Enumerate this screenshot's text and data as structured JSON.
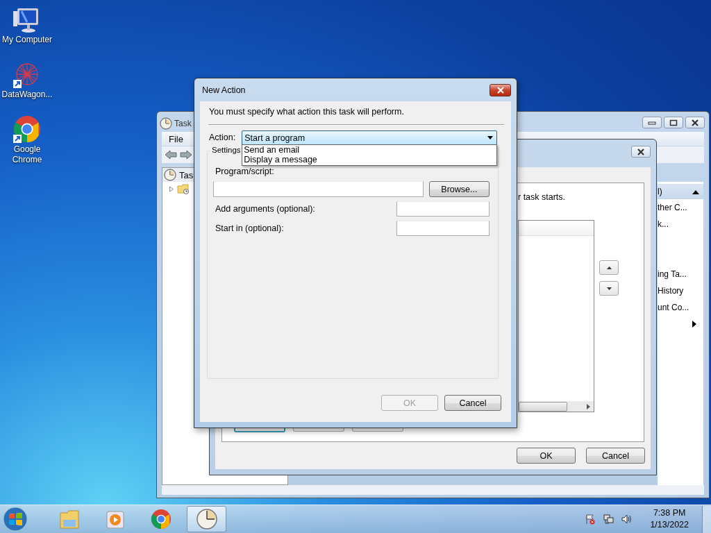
{
  "desktop": {
    "icons": [
      {
        "label": "My Computer",
        "kind": "computer",
        "shortcut": false
      },
      {
        "label": "DataWagon...",
        "kind": "network",
        "shortcut": true
      },
      {
        "label": "Google Chrome",
        "kind": "chrome",
        "shortcut": true
      }
    ]
  },
  "task_scheduler": {
    "title": "Task",
    "menu": [
      "File"
    ],
    "tree": [
      {
        "label": "Tas",
        "children": [
          {
            "expanded": false
          }
        ]
      }
    ],
    "actions": {
      "header": "l)",
      "expanded": true,
      "items": [
        {
          "kind": "text",
          "label": "ther C..."
        },
        {
          "kind": "text",
          "label": "k..."
        },
        {
          "kind": "text",
          "label": "ing Ta..."
        },
        {
          "kind": "text",
          "label": "History"
        },
        {
          "kind": "text",
          "label": "unt Co..."
        },
        {
          "kind": "submenu"
        }
      ]
    }
  },
  "create_task": {
    "text": "r task starts.",
    "buttons": [
      {
        "label": "OK"
      },
      {
        "label": "Cancel"
      }
    ]
  },
  "new_action": {
    "title": "New Action",
    "instruction": "You must specify what action this task will perform.",
    "action_label": "Action:",
    "action_value": "Start a program",
    "dropdown_open": true,
    "options": [
      {
        "label": "Send an email",
        "selected": false
      },
      {
        "label": "Display a message",
        "selected": false
      }
    ],
    "settings_label": "Settings",
    "program_label": "Program/script:",
    "browse": "Browse...",
    "fields": [
      {
        "label": "Add arguments (optional):"
      },
      {
        "label": "Start in (optional):"
      }
    ],
    "buttons": [
      {
        "label": "OK",
        "disabled": true
      },
      {
        "label": "Cancel",
        "disabled": false
      }
    ]
  },
  "taskbar": {
    "items": [
      {
        "kind": "explorer",
        "active": false
      },
      {
        "kind": "media",
        "active": false
      },
      {
        "kind": "chrome",
        "active": false
      },
      {
        "kind": "scheduler",
        "active": true
      }
    ],
    "tray": [
      {
        "kind": "flag"
      },
      {
        "kind": "network"
      },
      {
        "kind": "volume"
      }
    ],
    "time": "7:38 PM",
    "date": "1/13/2022"
  }
}
